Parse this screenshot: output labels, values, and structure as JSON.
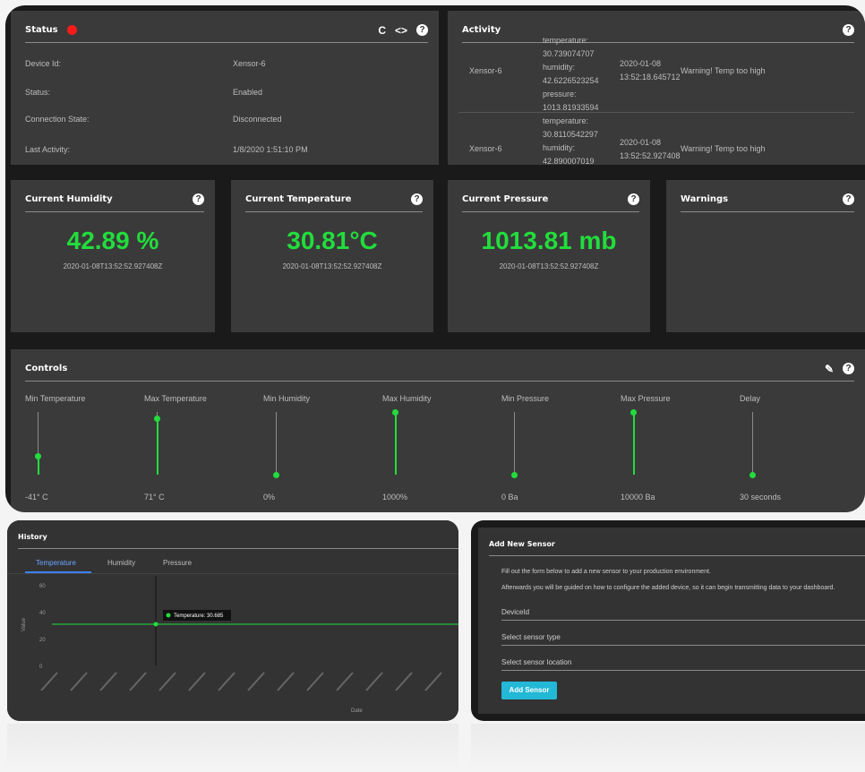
{
  "status_card": {
    "title": "Status",
    "rows": [
      {
        "key": "Device Id:",
        "value": "Xensor-6"
      },
      {
        "key": "Status:",
        "value": "Enabled"
      },
      {
        "key": "Connection State:",
        "value": "Disconnected"
      },
      {
        "key": "Last Activity:",
        "value": "1/8/2020 1:51:10 PM"
      }
    ],
    "icons": {
      "refresh": "C",
      "code": "<>",
      "help": "?"
    }
  },
  "activity_card": {
    "title": "Activity",
    "help": "?",
    "rows": [
      {
        "device": "Xensor-6",
        "data": "temperature: 30.739074707 humidity: 42.6226523254 pressure: 1013.81933594",
        "timestamp": "2020-01-08 13:52:18.645712",
        "message": "Warning! Temp too high"
      },
      {
        "device": "Xensor-6",
        "data": "temperature: 30.8110542297 humidity: 42.890007019",
        "timestamp": "2020-01-08 13:52:52.927408",
        "message": "Warning! Temp too high"
      }
    ]
  },
  "humidity_card": {
    "title": "Current Humidity",
    "value": "42.89 %",
    "timestamp": "2020-01-08T13:52:52.927408Z",
    "help": "?"
  },
  "temperature_card": {
    "title": "Current Temperature",
    "value": "30.81°C",
    "timestamp": "2020-01-08T13:52:52.927408Z",
    "help": "?"
  },
  "pressure_card": {
    "title": "Current Pressure",
    "value": "1013.81 mb",
    "timestamp": "2020-01-08T13:52:52.927408Z",
    "help": "?"
  },
  "warnings_card": {
    "title": "Warnings",
    "help": "?"
  },
  "controls_card": {
    "title": "Controls",
    "help": "?",
    "sliders": [
      {
        "label": "Min Temperature",
        "value": "-41° C",
        "level": 0.3
      },
      {
        "label": "Max Temperature",
        "value": "71° C",
        "level": 0.9
      },
      {
        "label": "Min Humidity",
        "value": "0%",
        "level": 0.0
      },
      {
        "label": "Max Humidity",
        "value": "1000%",
        "level": 1.0
      },
      {
        "label": "Min Pressure",
        "value": "0 Ba",
        "level": 0.0
      },
      {
        "label": "Max Pressure",
        "value": "10000 Ba",
        "level": 1.0
      },
      {
        "label": "Delay",
        "value": "30 seconds",
        "level": 0.0
      }
    ]
  },
  "history_card": {
    "title": "History",
    "tabs": [
      "Temperature",
      "Humidity",
      "Pressure"
    ],
    "active_tab": "Temperature",
    "tooltip": "Temperature: 30.685",
    "y_axis_label": "Value",
    "x_axis_label": "Date",
    "accent_color": "#3b82f6"
  },
  "chart_data": {
    "type": "line",
    "title": "",
    "xlabel": "Date",
    "ylabel": "Value",
    "ylim": [
      0,
      60
    ],
    "y_ticks": [
      "0",
      "20",
      "40",
      "60"
    ],
    "series": [
      {
        "name": "Temperature",
        "values": [
          30.7,
          30.7,
          30.7,
          30.7,
          30.7,
          30.7,
          30.7,
          30.7,
          30.7,
          30.7,
          30.7,
          30.7,
          30.7,
          30.7
        ]
      }
    ]
  },
  "add_sensor_card": {
    "title": "Add New Sensor",
    "intro_1": "Fill out the form below to add a new sensor to your production environment.",
    "intro_2": "Afterwards you will be guided on how to configure the added device, so it can begin transmitting data to your dashboard.",
    "device_id_placeholder": "DeviceId",
    "sensor_type_placeholder": "Select sensor type",
    "sensor_location_placeholder": "Select sensor location",
    "button_label": "Add Sensor",
    "button_color": "#22b8d6"
  },
  "colors": {
    "value_green": "#22dd3c",
    "status_red": "#ff1a1a",
    "card_bg": "#3a3a3a"
  }
}
